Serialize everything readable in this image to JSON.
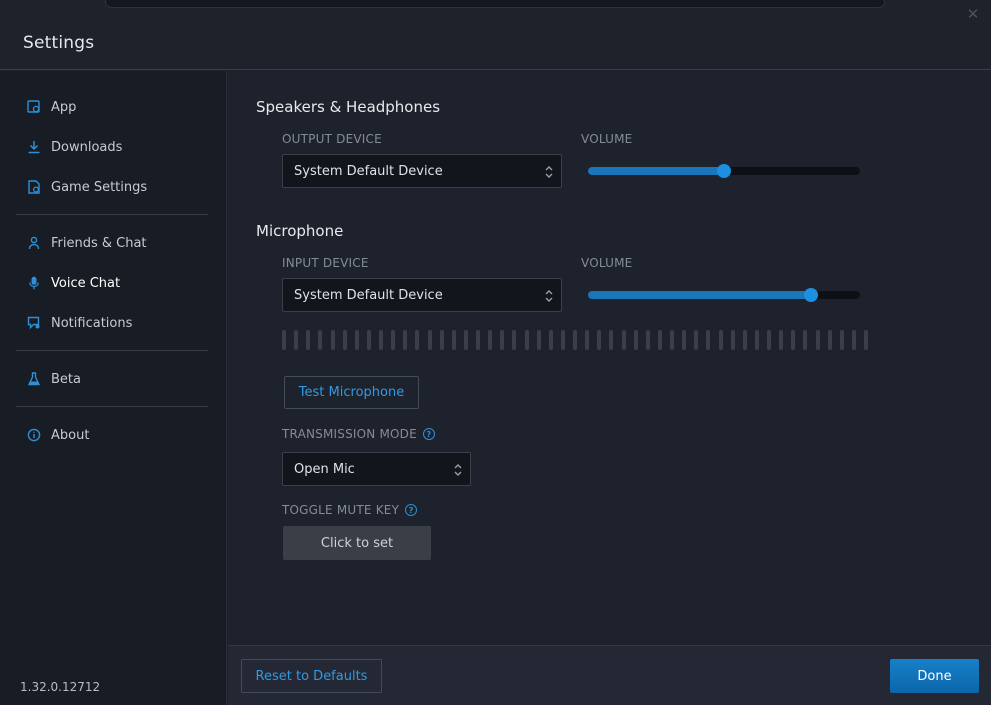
{
  "window": {
    "title": "Settings",
    "close_glyph": "✕"
  },
  "sidebar": {
    "groups": [
      [
        {
          "label": "App",
          "icon": "app-icon"
        },
        {
          "label": "Downloads",
          "icon": "download-icon"
        },
        {
          "label": "Game Settings",
          "icon": "game-settings-icon"
        }
      ],
      [
        {
          "label": "Friends & Chat",
          "icon": "friends-icon"
        },
        {
          "label": "Voice Chat",
          "icon": "microphone-icon",
          "active": true
        },
        {
          "label": "Notifications",
          "icon": "notification-icon"
        }
      ],
      [
        {
          "label": "Beta",
          "icon": "flask-icon"
        }
      ],
      [
        {
          "label": "About",
          "icon": "info-icon"
        }
      ]
    ],
    "version": "1.32.0.12712"
  },
  "speakers": {
    "title": "Speakers & Headphones",
    "output_label": "OUTPUT DEVICE",
    "output_value": "System Default Device",
    "volume_label": "VOLUME",
    "volume_percent": 50
  },
  "microphone": {
    "title": "Microphone",
    "input_label": "INPUT DEVICE",
    "input_value": "System Default Device",
    "volume_label": "VOLUME",
    "volume_percent": 82,
    "test_button": "Test Microphone",
    "transmission_label": "TRANSMISSION MODE",
    "transmission_value": "Open Mic",
    "mute_key_label": "TOGGLE MUTE KEY",
    "mute_key_button": "Click to set",
    "help_glyph": "?"
  },
  "footer": {
    "reset_label": "Reset to Defaults",
    "done_label": "Done"
  },
  "colors": {
    "accent": "#1d8fe0",
    "link": "#2e9ae6"
  }
}
